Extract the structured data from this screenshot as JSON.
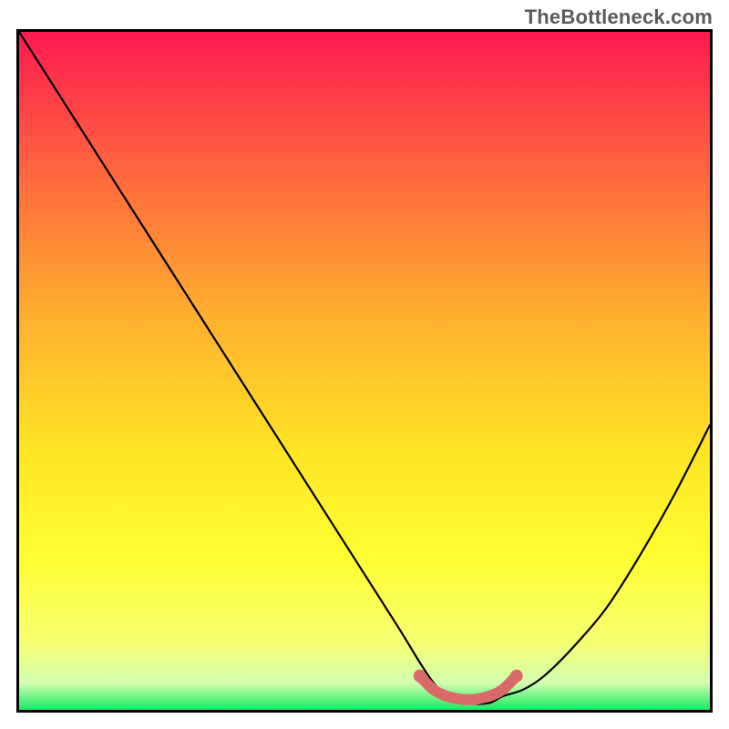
{
  "watermark": "TheBottleneck.com",
  "colors": {
    "top": "#ff1a51",
    "mid1": "#ff6b3d",
    "mid2": "#ffb02f",
    "mid3": "#ffe524",
    "mid4": "#ffff33",
    "mid5": "#f7ff71",
    "bottom1": "#d3ffb0",
    "bottom2": "#17eb63",
    "curve": "#000000",
    "marker": "#d96a67",
    "border": "#000000"
  },
  "chart_data": {
    "type": "line",
    "title": "",
    "xlabel": "",
    "ylabel": "",
    "xlim": [
      0,
      100
    ],
    "ylim": [
      0,
      100
    ],
    "series": [
      {
        "name": "bottleneck-curve",
        "x": [
          0,
          5,
          10,
          15,
          20,
          25,
          30,
          35,
          40,
          45,
          50,
          55,
          58,
          60,
          62,
          65,
          68,
          70,
          73,
          76,
          80,
          85,
          90,
          95,
          100
        ],
        "y": [
          100,
          92,
          84,
          76,
          68,
          60,
          52,
          44,
          36,
          28,
          20,
          12,
          7,
          4,
          2,
          1,
          1,
          2,
          3,
          5,
          9,
          15,
          23,
          32,
          42
        ]
      },
      {
        "name": "highlight-segment",
        "x": [
          58,
          60,
          62,
          65,
          68,
          70,
          72
        ],
        "y": [
          5,
          3,
          2,
          1.5,
          2,
          3,
          5
        ]
      }
    ],
    "annotations": []
  }
}
